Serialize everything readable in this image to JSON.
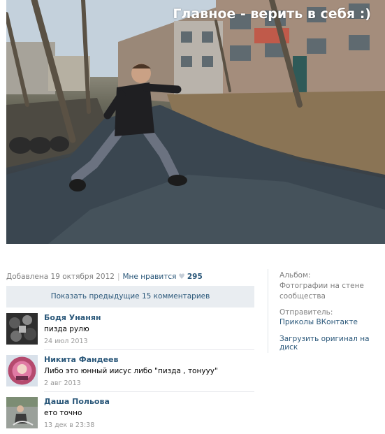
{
  "photo": {
    "caption": "Главное - верить в себя :)"
  },
  "meta": {
    "added": "Добавлена 19 октября 2012",
    "separator": "|",
    "like_label": "Мне нравится",
    "like_icon": "heart-icon",
    "like_count": "295"
  },
  "show_previous": "Показать предыдущие 15 комментариев",
  "comments": [
    {
      "author": "Бодя Унанян",
      "text": "пизда рулю",
      "date": "24 июл 2013"
    },
    {
      "author": "Никита Фандеев",
      "text": "Либо это юнный иисус либо \"пизда , тонууу\"",
      "date": "2 авг 2013"
    },
    {
      "author": "Даша Польова",
      "text": "ето точно",
      "date": "13 дек в 23:38"
    }
  ],
  "sidebar": {
    "album_label": "Альбом:",
    "album_line1": "Фотографии на стене",
    "album_line2": "сообщества",
    "sender_label": "Отправитель:",
    "sender_name": "Приколы ВКонтакте",
    "download": "Загрузить оригинал на диск"
  },
  "colors": {
    "link": "#2b587a",
    "muted": "#7f7f7f",
    "button_bg": "#e9edf1"
  }
}
